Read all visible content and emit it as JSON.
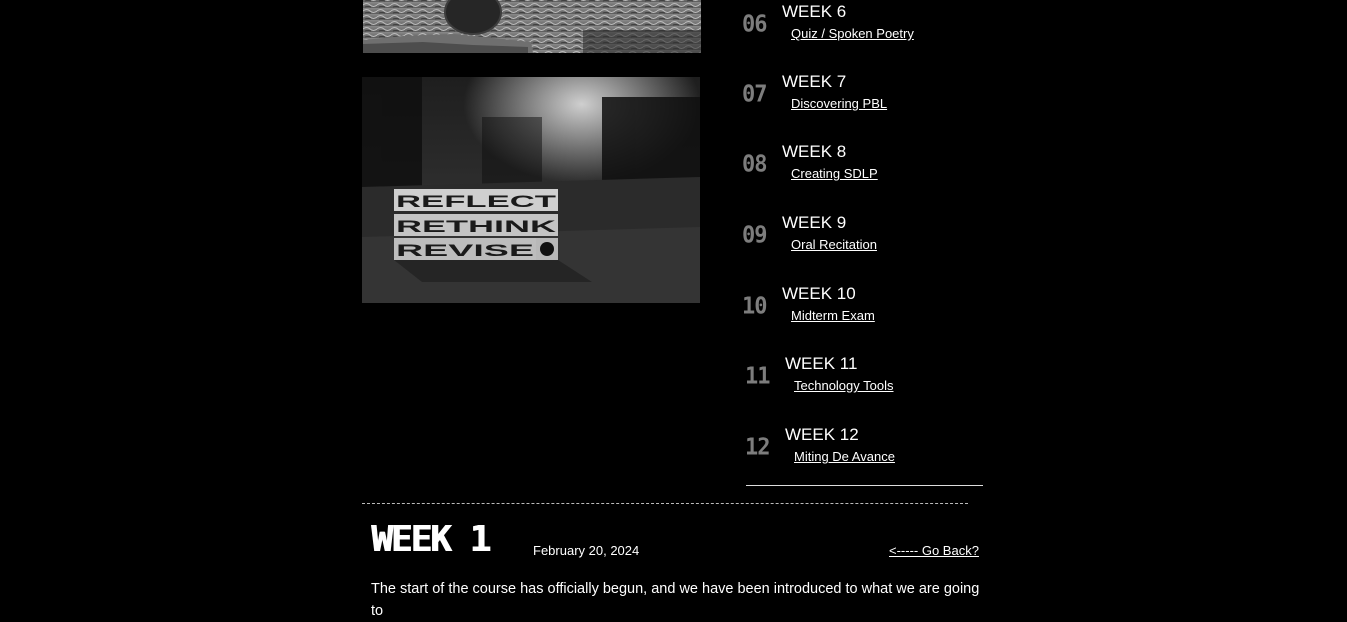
{
  "weeks": [
    {
      "num": "06",
      "title": "WEEK 6",
      "link": "Quiz / Spoken Poetry"
    },
    {
      "num": "07",
      "title": "WEEK 7",
      "link": "Discovering PBL"
    },
    {
      "num": "08",
      "title": "WEEK 8",
      "link": "Creating SDLP"
    },
    {
      "num": "09",
      "title": "WEEK 9",
      "link": "Oral Recitation"
    },
    {
      "num": "10",
      "title": "WEEK 10",
      "link": "Midterm Exam"
    },
    {
      "num": "11",
      "title": "WEEK 11",
      "link": "Technology Tools"
    },
    {
      "num": "12",
      "title": "WEEK 12",
      "link": "Miting De Avance"
    }
  ],
  "photo_blocks": {
    "row1": "REFLECT",
    "row2": "RETHINK",
    "row3": "REVISE"
  },
  "post": {
    "heading": "WEEK 1",
    "date": "February 20, 2024",
    "go_back": "<----- Go Back?",
    "body": "The start of the course has officially begun, and we have been introduced to what we are going to"
  }
}
